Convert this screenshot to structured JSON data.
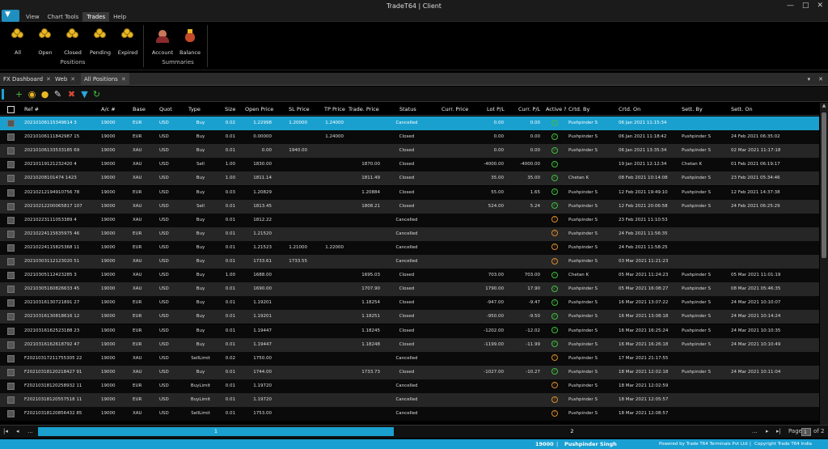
{
  "window": {
    "title": "TradeT64 | Client",
    "minimize": "—",
    "maximize": "□",
    "close": "✕"
  },
  "menu": [
    "View",
    "Chart Tools",
    "Trades",
    "Help"
  ],
  "menu_active": "Trades",
  "ribbon": {
    "positions_buttons": [
      "All",
      "Open",
      "Closed",
      "Pending",
      "Expired"
    ],
    "positions_label": "Positions",
    "summaries_buttons": [
      "Account",
      "Balance"
    ],
    "summaries_label": "Summaries"
  },
  "doc_tabs": [
    {
      "label": "FX Dashboard",
      "close": "✕"
    },
    {
      "label": "Web",
      "close": "✕"
    },
    {
      "label": "All Positions",
      "close": "✕"
    }
  ],
  "doc_tabs_right": [
    "▾",
    "✕"
  ],
  "toolbar_icons": [
    {
      "name": "add-icon",
      "glyph": "+",
      "color": "#3fbf3f"
    },
    {
      "name": "eye-icon",
      "glyph": "◉",
      "color": "#e9b825"
    },
    {
      "name": "coin-icon",
      "glyph": "●",
      "color": "#e9b825"
    },
    {
      "name": "edit-icon",
      "glyph": "✎",
      "color": "#dddddd"
    },
    {
      "name": "delete-icon",
      "glyph": "✖",
      "color": "#d94a3a"
    },
    {
      "name": "filter-icon",
      "glyph": "▼",
      "color": "#2aa6e0"
    },
    {
      "name": "refresh-icon",
      "glyph": "↻",
      "color": "#3fbf3f"
    }
  ],
  "grid": {
    "columns": [
      "Ref #",
      "A/c #",
      "Base",
      "Quot",
      "Type",
      "Size",
      "Open Price",
      "SL Price",
      "TP Price",
      "Trade. Price",
      "Status",
      "Curr. Price",
      "Lot P/L",
      "Curr. P/L",
      "Active ?",
      "Crtd. By",
      "Crtd. On",
      "Sett. By",
      "Sett. On"
    ],
    "rows": [
      [
        "20210106115349614 3",
        "19000",
        "EUR",
        "USD",
        "Buy",
        "0.02",
        "1.22998",
        "1.20000",
        "1.24000",
        "",
        "Cancelled",
        "",
        "0.00",
        "0.00",
        "check",
        "Pushpinder S",
        "06 Jan 2021 11:15:34",
        "",
        ""
      ],
      [
        "20210106111842987 15",
        "19000",
        "EUR",
        "USD",
        "Buy",
        "0.01",
        "0.00000",
        "",
        "1.24000",
        "",
        "Closed",
        "",
        "0.00",
        "0.00",
        "check",
        "Pushpinder S",
        "06 Jan 2021 11:18:42",
        "Pushpinder S",
        "24 Feb 2021 06:35:02"
      ],
      [
        "20210106133533185 69",
        "19000",
        "XAU",
        "USD",
        "Buy",
        "0.01",
        "0.00",
        "1940.00",
        "",
        "",
        "Closed",
        "",
        "0.00",
        "0.00",
        "check",
        "Pushpinder S",
        "06 Jan 2021 13:35:34",
        "Pushpinder S",
        "02 Mar 2021 11:17:18"
      ],
      [
        "20210119121232420 4",
        "19000",
        "XAU",
        "USD",
        "Sell",
        "1.00",
        "1830.00",
        "",
        "",
        "1870.00",
        "Closed",
        "",
        "-4000.00",
        "-4000.00",
        "check",
        "",
        "19 Jan 2021 12:12:34",
        "Chetan K",
        "01 Feb 2021 06:19:17"
      ],
      [
        "20210208101474 1423",
        "19000",
        "XAU",
        "USD",
        "Buy",
        "1.00",
        "1811.14",
        "",
        "",
        "1811.49",
        "Closed",
        "",
        "35.00",
        "35.00",
        "check",
        "Chetan K",
        "08 Feb 2021 10:14:08",
        "Pushpinder S",
        "23 Feb 2021 05:34:46"
      ],
      [
        "20210212194910756 78",
        "19000",
        "EUR",
        "USD",
        "Buy",
        "0.03",
        "1.20829",
        "",
        "",
        "1.20884",
        "Closed",
        "",
        "55.00",
        "1.65",
        "check",
        "Pushpinder S",
        "12 Feb 2021 19:49:10",
        "Pushpinder S",
        "12 Feb 2021 14:37:38"
      ],
      [
        "20210212200065817 107",
        "19000",
        "XAU",
        "USD",
        "Sell",
        "0.01",
        "1813.45",
        "",
        "",
        "1808.21",
        "Closed",
        "",
        "524.00",
        "5.24",
        "check",
        "Pushpinder S",
        "12 Feb 2021 20:06:58",
        "Pushpinder S",
        "24 Feb 2021 06:25:29"
      ],
      [
        "20210223111053389 4",
        "19000",
        "XAU",
        "USD",
        "Buy",
        "0.01",
        "1812.22",
        "",
        "",
        "",
        "Cancelled",
        "",
        "",
        "",
        "info",
        "Pushpinder S",
        "23 Feb 2021 11:10:53",
        "",
        ""
      ],
      [
        "20210224115635975 46",
        "19000",
        "EUR",
        "USD",
        "Buy",
        "0.01",
        "1.21520",
        "",
        "",
        "",
        "Cancelled",
        "",
        "",
        "",
        "info",
        "Pushpinder S",
        "24 Feb 2021 11:56:35",
        "",
        ""
      ],
      [
        "20210224115825368 11",
        "19000",
        "EUR",
        "USD",
        "Buy",
        "0.01",
        "1.21523",
        "1.21000",
        "1.22000",
        "",
        "Cancelled",
        "",
        "",
        "",
        "info",
        "Pushpinder S",
        "24 Feb 2021 11:58:25",
        "",
        ""
      ],
      [
        "20210303112123020 51",
        "19000",
        "XAU",
        "USD",
        "Buy",
        "0.01",
        "1733.61",
        "1733.55",
        "",
        "",
        "Cancelled",
        "",
        "",
        "",
        "info",
        "Pushpinder S",
        "03 Mar 2021 11:21:23",
        "",
        ""
      ],
      [
        "20210305112423285 3",
        "19000",
        "XAU",
        "USD",
        "Buy",
        "1.00",
        "1688.00",
        "",
        "",
        "1695.03",
        "Closed",
        "",
        "703.00",
        "703.00",
        "check",
        "Chetan K",
        "05 Mar 2021 11:24:23",
        "Pushpinder S",
        "05 Mar 2021 11:01:19"
      ],
      [
        "20210305160826633 45",
        "19000",
        "XAU",
        "USD",
        "Buy",
        "0.01",
        "1690.00",
        "",
        "",
        "1707.90",
        "Closed",
        "",
        "1790.00",
        "17.90",
        "check",
        "Pushpinder S",
        "05 Mar 2021 16:08:27",
        "Pushpinder S",
        "08 Mar 2021 05:46:35"
      ],
      [
        "20210316130721891 27",
        "19000",
        "EUR",
        "USD",
        "Buy",
        "0.01",
        "1.19201",
        "",
        "",
        "1.18254",
        "Closed",
        "",
        "-947.00",
        "-9.47",
        "check",
        "Pushpinder S",
        "16 Mar 2021 13:07:22",
        "Pushpinder S",
        "24 Mar 2021 10:10:07"
      ],
      [
        "20210316130818616 12",
        "19000",
        "EUR",
        "USD",
        "Buy",
        "0.01",
        "1.19201",
        "",
        "",
        "1.18251",
        "Closed",
        "",
        "-950.00",
        "-9.50",
        "check",
        "Pushpinder S",
        "16 Mar 2021 13:08:18",
        "Pushpinder S",
        "24 Mar 2021 10:14:24"
      ],
      [
        "20210316162523188 23",
        "19000",
        "EUR",
        "USD",
        "Buy",
        "0.01",
        "1.19447",
        "",
        "",
        "1.18245",
        "Closed",
        "",
        "-1202.00",
        "-12.02",
        "check",
        "Pushpinder S",
        "16 Mar 2021 16:25:24",
        "Pushpinder S",
        "24 Mar 2021 10:10:35"
      ],
      [
        "20210316162618792 47",
        "19000",
        "EUR",
        "USD",
        "Buy",
        "0.01",
        "1.19447",
        "",
        "",
        "1.18248",
        "Closed",
        "",
        "-1199.00",
        "-11.99",
        "check",
        "Pushpinder S",
        "16 Mar 2021 16:26:18",
        "Pushpinder S",
        "24 Mar 2021 10:10:49"
      ],
      [
        "F20210317211755305 22",
        "19000",
        "XAU",
        "USD",
        "SellLimit",
        "0.02",
        "1750.00",
        "",
        "",
        "",
        "Cancelled",
        "",
        "",
        "",
        "info",
        "Pushpinder S",
        "17 Mar 2021 21:17:55",
        "",
        ""
      ],
      [
        "F20210318120218427 91",
        "19000",
        "XAU",
        "USD",
        "Buy",
        "0.01",
        "1744.00",
        "",
        "",
        "1733.73",
        "Closed",
        "",
        "-1027.00",
        "-10.27",
        "check",
        "Pushpinder S",
        "18 Mar 2021 12:02:18",
        "Pushpinder S",
        "24 Mar 2021 10:11:04"
      ],
      [
        "F20210318120258932 11",
        "19000",
        "EUR",
        "USD",
        "BuyLimit",
        "0.01",
        "1.19720",
        "",
        "",
        "",
        "Cancelled",
        "",
        "",
        "",
        "info",
        "Pushpinder S",
        "18 Mar 2021 12:02:59",
        "",
        ""
      ],
      [
        "F20210318120557518 11",
        "19000",
        "EUR",
        "USD",
        "BuyLimit",
        "0.01",
        "1.19720",
        "",
        "",
        "",
        "Cancelled",
        "",
        "",
        "",
        "info",
        "Pushpinder S",
        "18 Mar 2021 12:05:57",
        "",
        ""
      ],
      [
        "F20210318120856432 85",
        "19000",
        "XAU",
        "USD",
        "SellLimit",
        "0.01",
        "1753.00",
        "",
        "",
        "",
        "Cancelled",
        "",
        "",
        "",
        "info",
        "Pushpinder S",
        "18 Mar 2021 12:08:57",
        "",
        ""
      ]
    ]
  },
  "pager": {
    "first": "|◂",
    "prev": "◂",
    "ellipsis_left": "...",
    "page1": "1",
    "page2": "2",
    "ellipsis_right": "...",
    "next": "▸",
    "last": "▸|",
    "page_label": "Page",
    "page_value": "1",
    "of_label": "of 2"
  },
  "status": {
    "account": "19000",
    "separator": "|",
    "user": "Pushpinder Singh",
    "powered": "Powered by Trade T64 Terminals Pvt Ltd",
    "copyright": "Copyright Trade T64 India Limited"
  }
}
